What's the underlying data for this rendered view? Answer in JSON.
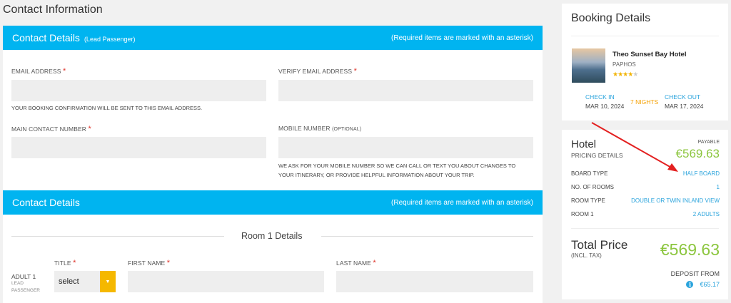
{
  "page_title": "Contact Information",
  "contact_section": {
    "title": "Contact Details",
    "subtitle": "(Lead Passenger)",
    "required_note": "(Required items are marked with an asterisk)",
    "email_label": "EMAIL ADDRESS",
    "verify_email_label": "VERIFY EMAIL ADDRESS",
    "email_hint": "YOUR BOOKING CONFIRMATION WILL BE SENT TO THIS EMAIL ADDRESS.",
    "main_contact_label": "MAIN CONTACT NUMBER",
    "mobile_label": "MOBILE NUMBER",
    "mobile_optional": "(OPTIONAL)",
    "mobile_hint_1": "WE ASK FOR YOUR MOBILE NUMBER SO WE CAN CALL OR TEXT YOU ABOUT CHANGES TO",
    "mobile_hint_2": "YOUR ITINERARY, OR PROVIDE HELPFUL INFORMATION ABOUT YOUR TRIP.",
    "email_value": "",
    "verify_email_value": "",
    "main_contact_value": "",
    "mobile_value": "",
    "asterisk": "*"
  },
  "passenger_section": {
    "title": "Contact Details",
    "required_note": "(Required items are marked with an asterisk)",
    "room_title": "Room 1 Details",
    "title_label": "TITLE",
    "first_name_label": "FIRST NAME",
    "last_name_label": "LAST NAME",
    "adult_label": "ADULT 1",
    "lead_label_1": "LEAD",
    "lead_label_2": "PASSENGER",
    "title_select_value": "select",
    "first_name_value": "",
    "last_name_value": ""
  },
  "booking": {
    "heading": "Booking Details",
    "hotel_name": "Theo Sunset Bay Hotel",
    "location": "PAPHOS",
    "stars_filled": "★★★★",
    "stars_empty": "★",
    "rating": 4,
    "check_in_label": "CHECK IN",
    "check_in_date": "MAR 10, 2024",
    "nights": "7 NIGHTS",
    "check_out_label": "CHECK OUT",
    "check_out_date": "MAR 17, 2024"
  },
  "pricing": {
    "hotel_label": "Hotel",
    "pricing_details": "PRICING DETAILS",
    "payable_label": "PAYABLE",
    "amount": "€569.63",
    "rows": [
      {
        "key": "BOARD TYPE",
        "value": "HALF BOARD"
      },
      {
        "key": "NO. OF ROOMS",
        "value": "1"
      },
      {
        "key": "ROOM TYPE",
        "value": "DOUBLE OR TWIN INLAND VIEW"
      },
      {
        "key": "ROOM 1",
        "value": "2 ADULTS"
      }
    ],
    "total_label": "Total Price",
    "incl_tax": "(INCL. TAX)",
    "total_amount": "€569.63",
    "deposit_label": "DEPOSIT FROM",
    "deposit_amount": "€65.17"
  },
  "colors": {
    "accent": "#00b4f0",
    "price_green": "#8cc63f",
    "link_blue": "#29a3dc",
    "select_yellow": "#f5b800",
    "arrow_red": "#e32020"
  }
}
